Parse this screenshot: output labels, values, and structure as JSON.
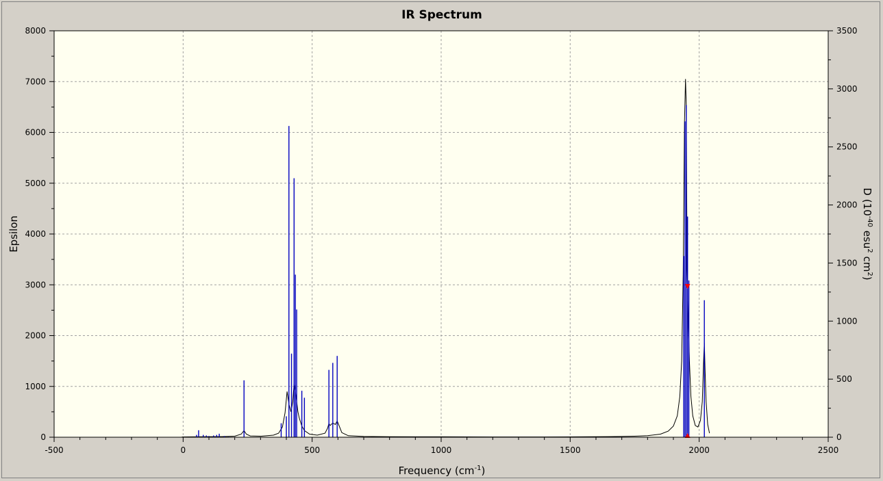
{
  "colors": {
    "background": "#d4d0c8",
    "plot_background": "#fffff0",
    "grid": "#a0a0a0",
    "spectrum_line": "#000000",
    "stick_bars": "#0000c0",
    "marker": "#ff0000"
  },
  "chart_data": {
    "type": "line",
    "title": "IR Spectrum",
    "xlabel_main": "Frequency (cm",
    "xlabel_sup": "-1",
    "xlabel_end": ")",
    "ylabel": "Epsilon",
    "y2label": {
      "prefix": "D (10",
      "sup1": "-40",
      "mid": " esu",
      "sup2": "2",
      "mid2": " cm",
      "sup3": "2",
      "end": ")"
    },
    "xlim": [
      -500,
      2500
    ],
    "ylim": [
      0,
      8000
    ],
    "y2lim": [
      0,
      3500
    ],
    "grid": true,
    "xticks": [
      -500,
      0,
      500,
      1000,
      1500,
      2000,
      2500
    ],
    "yticks": [
      0,
      1000,
      2000,
      3000,
      4000,
      5000,
      6000,
      7000,
      8000
    ],
    "y2ticks": [
      0,
      500,
      1000,
      1500,
      2000,
      2500,
      3000,
      3500
    ],
    "sticks": {
      "name": "D",
      "x": [
        52,
        60,
        78,
        90,
        100,
        118,
        130,
        140,
        160,
        175,
        236,
        380,
        400,
        410,
        420,
        430,
        435,
        440,
        460,
        470,
        565,
        580,
        597,
        1940,
        1945,
        1950,
        1955,
        1960,
        2020
      ],
      "values": [
        20,
        60,
        20,
        15,
        10,
        15,
        20,
        30,
        10,
        5,
        490,
        120,
        180,
        2680,
        720,
        2230,
        1400,
        1100,
        400,
        340,
        580,
        640,
        700,
        1560,
        2720,
        2860,
        1900,
        1350,
        1180
      ]
    },
    "spectrum": {
      "name": "Epsilon",
      "x": [
        -5,
        50,
        100,
        150,
        200,
        225,
        236,
        245,
        260,
        300,
        350,
        370,
        385,
        395,
        403,
        410,
        418,
        425,
        430,
        435,
        440,
        445,
        450,
        460,
        470,
        490,
        520,
        550,
        560,
        565,
        570,
        580,
        590,
        597,
        605,
        615,
        640,
        700,
        800,
        900,
        1000,
        1100,
        1200,
        1300,
        1400,
        1500,
        1600,
        1700,
        1750,
        1800,
        1850,
        1880,
        1900,
        1915,
        1925,
        1932,
        1938,
        1943,
        1947,
        1950,
        1953,
        1957,
        1962,
        1968,
        1975,
        1985,
        1995,
        2005,
        2012,
        2017,
        2020,
        2023,
        2027,
        2033,
        2040
      ],
      "values": [
        5,
        8,
        10,
        12,
        20,
        60,
        130,
        60,
        25,
        20,
        40,
        80,
        200,
        480,
        900,
        650,
        500,
        700,
        1050,
        900,
        700,
        500,
        380,
        220,
        130,
        60,
        40,
        80,
        180,
        270,
        230,
        280,
        250,
        320,
        220,
        90,
        30,
        15,
        10,
        8,
        8,
        7,
        6,
        6,
        6,
        7,
        10,
        15,
        20,
        30,
        60,
        120,
        220,
        420,
        800,
        1500,
        3200,
        6200,
        7050,
        6550,
        3300,
        2400,
        1500,
        800,
        420,
        230,
        200,
        330,
        700,
        1500,
        1860,
        1300,
        700,
        250,
        80
      ]
    },
    "markers": [
      {
        "x": 1955,
        "y2": 1290,
        "direction": "down"
      },
      {
        "x": 1955,
        "y2": 0,
        "direction": "up"
      }
    ]
  }
}
